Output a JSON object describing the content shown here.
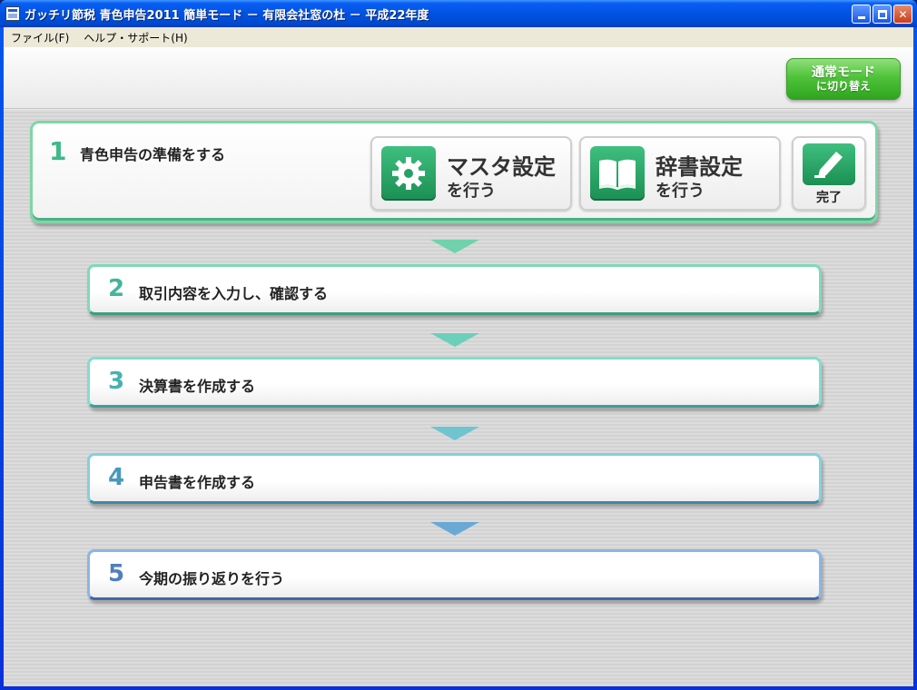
{
  "window": {
    "title": "ガッチリ節税 青色申告2011 簡単モード － 有限会社窓の杜 － 平成22年度"
  },
  "menu": {
    "file": "ファイル(F)",
    "help": "ヘルプ・サポート(H)"
  },
  "mode_button": {
    "line1": "通常モード",
    "line2": "に切り替え"
  },
  "steps": [
    {
      "num": "1",
      "label": "青色申告の準備をする",
      "color": "#3fb98a",
      "actions": {
        "master": {
          "line1": "マスタ設定",
          "line2": "を行う",
          "icon": "gear-icon"
        },
        "dictionary": {
          "line1": "辞書設定",
          "line2": "を行う",
          "icon": "book-icon"
        },
        "done": {
          "label": "完了",
          "icon": "pencil-icon"
        }
      }
    },
    {
      "num": "2",
      "label": "取引内容を入力し、確認する",
      "color": "#44b59a"
    },
    {
      "num": "3",
      "label": "決算書を作成する",
      "color": "#45b2b0"
    },
    {
      "num": "4",
      "label": "申告書を作成する",
      "color": "#4a98ba"
    },
    {
      "num": "5",
      "label": "今期の振り返りを行う",
      "color": "#4f7fbf"
    }
  ]
}
